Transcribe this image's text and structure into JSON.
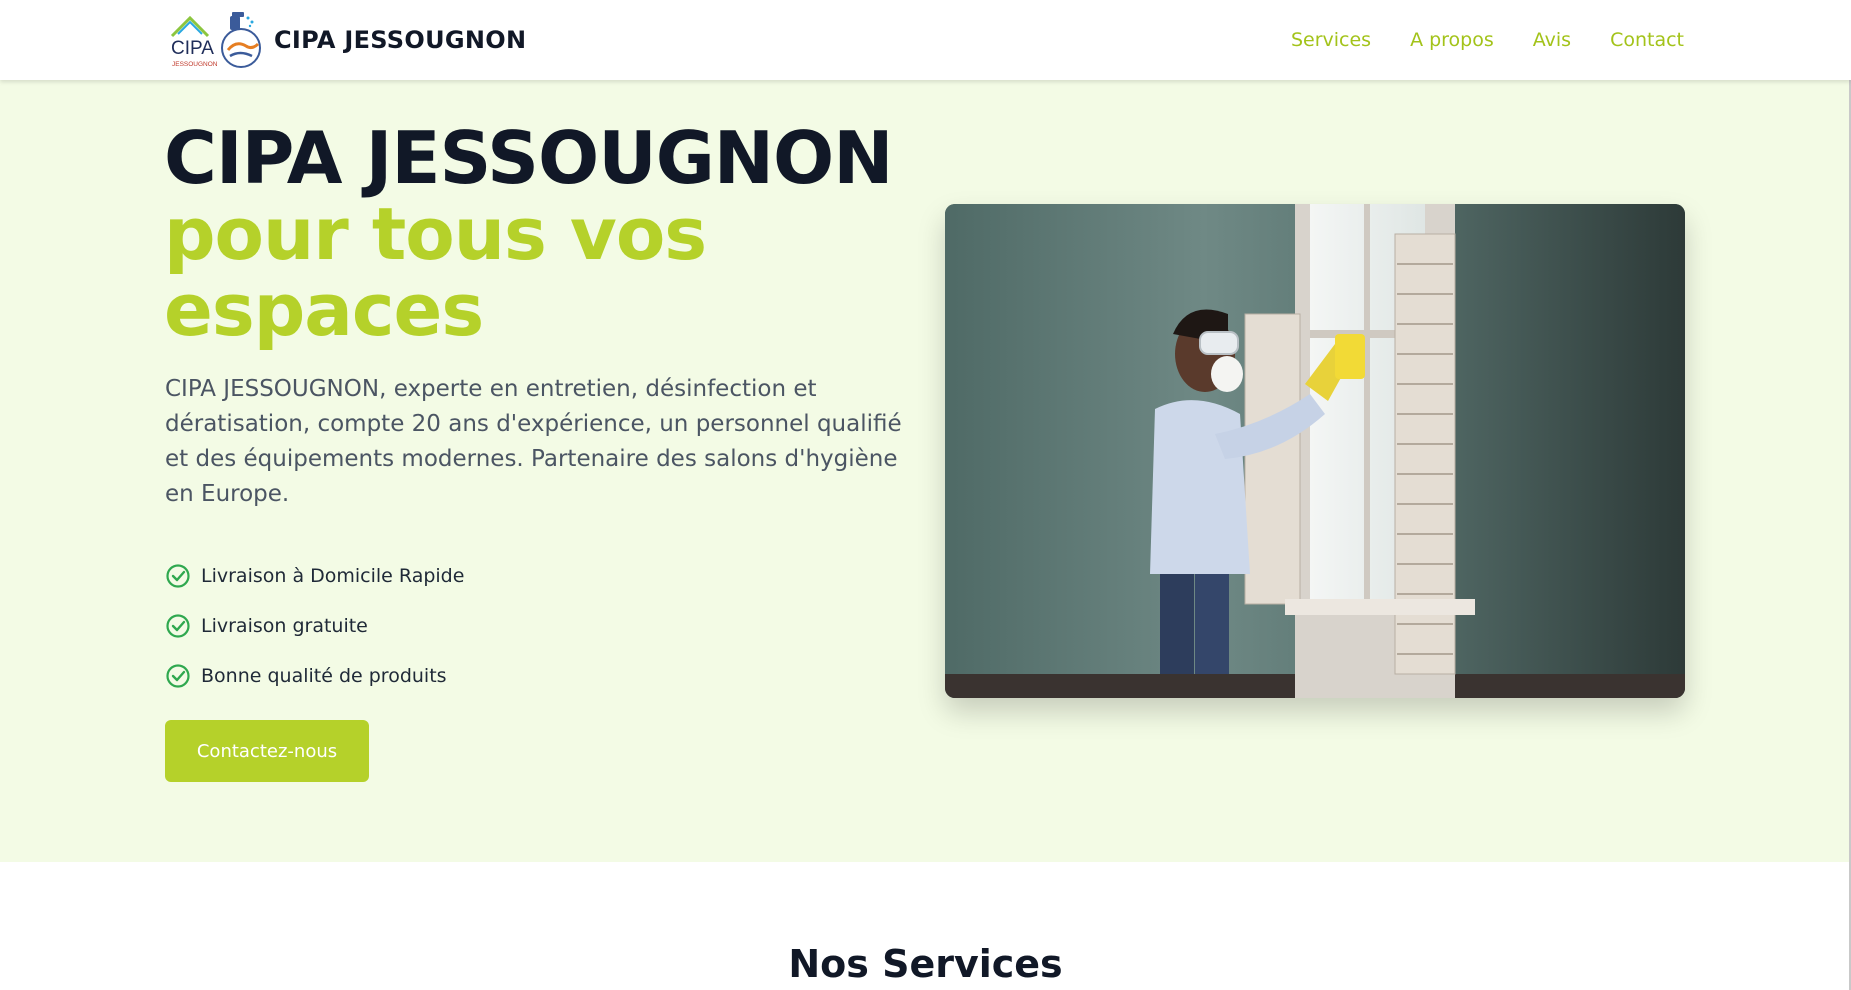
{
  "header": {
    "brand_name": "CIPA JESSOUGNON",
    "logo_text": "CIPA",
    "logo_subtext": "JESSOUGNON",
    "nav": [
      {
        "label": "Services"
      },
      {
        "label": "A propos"
      },
      {
        "label": "Avis"
      },
      {
        "label": "Contact"
      }
    ]
  },
  "hero": {
    "title_line1": "CIPA JESSOUGNON",
    "title_line2": "pour tous vos",
    "title_line3": "espaces",
    "description": "CIPA JESSOUGNON, experte en entretien, désinfection et dératisation, compte 20 ans d'expérience, un personnel qualifié et des équipements modernes. Partenaire des salons d'hygiène en Europe.",
    "features": [
      {
        "label": "Livraison à Domicile Rapide",
        "icon": "check-circle-icon"
      },
      {
        "label": "Livraison gratuite",
        "icon": "check-circle-icon"
      },
      {
        "label": "Bonne qualité de produits",
        "icon": "check-circle-icon"
      }
    ],
    "cta_label": "Contactez-nous"
  },
  "services": {
    "title": "Nos Services"
  },
  "colors": {
    "accent": "#b5d12a",
    "nav_link": "#a3c31a",
    "hero_bg": "#f3fbe5",
    "heading": "#111827",
    "body_text": "#4b5563"
  }
}
